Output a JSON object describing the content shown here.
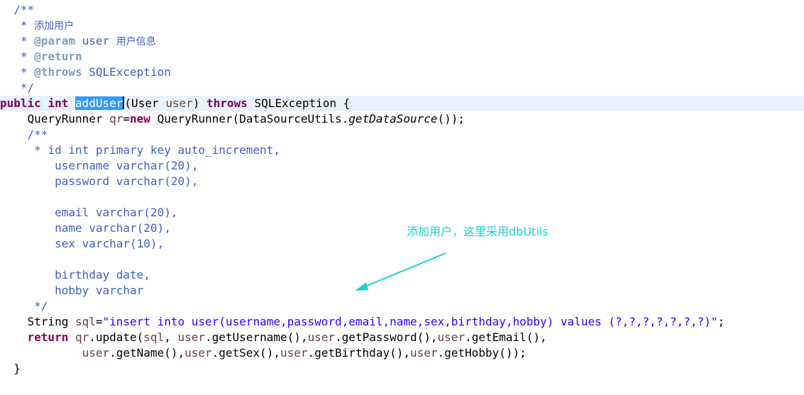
{
  "colors": {
    "keyword": "#7f0055",
    "comment": "#3f5fbf",
    "doc_tag": "#7f9fbf",
    "string": "#2a00ff",
    "local_var": "#6a3e3e",
    "field": "#0000c0",
    "selection": "#3399ff",
    "current_line": "#e8f2fe",
    "annotation": "#1ad0d0"
  },
  "code": {
    "l1": {
      "a": "  /**"
    },
    "l2": {
      "a": "   * ",
      "b": "添加用户"
    },
    "l3": {
      "a": "   * ",
      "b": "@param",
      "c": " user ",
      "d": "用户信息"
    },
    "l4": {
      "a": "   * ",
      "b": "@return"
    },
    "l5": {
      "a": "   * ",
      "b": "@throws",
      "c": " SQLException"
    },
    "l6": {
      "a": "   */"
    },
    "l7": {
      "a": "public",
      "b": " ",
      "c": "int",
      "d": " ",
      "e": "addUser",
      "f": "(User ",
      "g": "user",
      "h": ") ",
      "i": "throws",
      "j": " SQLException {"
    },
    "l8": {
      "a": "    QueryRunner ",
      "b": "qr",
      "c": "=",
      "d": "new",
      "e": " QueryRunner(DataSourceUtils.",
      "f": "getDataSource",
      "g": "());"
    },
    "l9": {
      "a": "    /**"
    },
    "l10": {
      "a": "     * id int primary key auto_increment,"
    },
    "l11": {
      "a": "        username varchar(20),"
    },
    "l12": {
      "a": "        password varchar(20),"
    },
    "l13": {
      "a": ""
    },
    "l14": {
      "a": "        email varchar(20),"
    },
    "l15": {
      "a": "        name varchar(20),"
    },
    "l16": {
      "a": "        sex varchar(10),"
    },
    "l17": {
      "a": ""
    },
    "l18": {
      "a": "        birthday date,"
    },
    "l19": {
      "a": "        hobby varchar"
    },
    "l20": {
      "a": "     */"
    },
    "l21": {
      "a": "    String ",
      "b": "sql",
      "c": "=",
      "d": "\"insert into user(username,password,email,name,sex,birthday,hobby) values (?,?,?,?,?,?,?)\"",
      "e": ";"
    },
    "l22": {
      "a": "    ",
      "b": "return",
      "c": " ",
      "d": "qr",
      "e": ".update(",
      "f": "sql",
      "g": ", ",
      "h": "user",
      "i": ".getUsername(),",
      "j": "user",
      "k": ".getPassword(),",
      "l": "user",
      "m": ".getEmail(),"
    },
    "l23": {
      "a": "            ",
      "b": "user",
      "c": ".getName(),",
      "d": "user",
      "e": ".getSex(),",
      "f": "user",
      "g": ".getBirthday(),",
      "h": "user",
      "i": ".getHobby());"
    },
    "l24": {
      "a": "  }"
    }
  },
  "annotation": {
    "text_a": "添加用户，这里采用",
    "text_b": "dbUtils",
    "color": "#1ad0d0"
  }
}
